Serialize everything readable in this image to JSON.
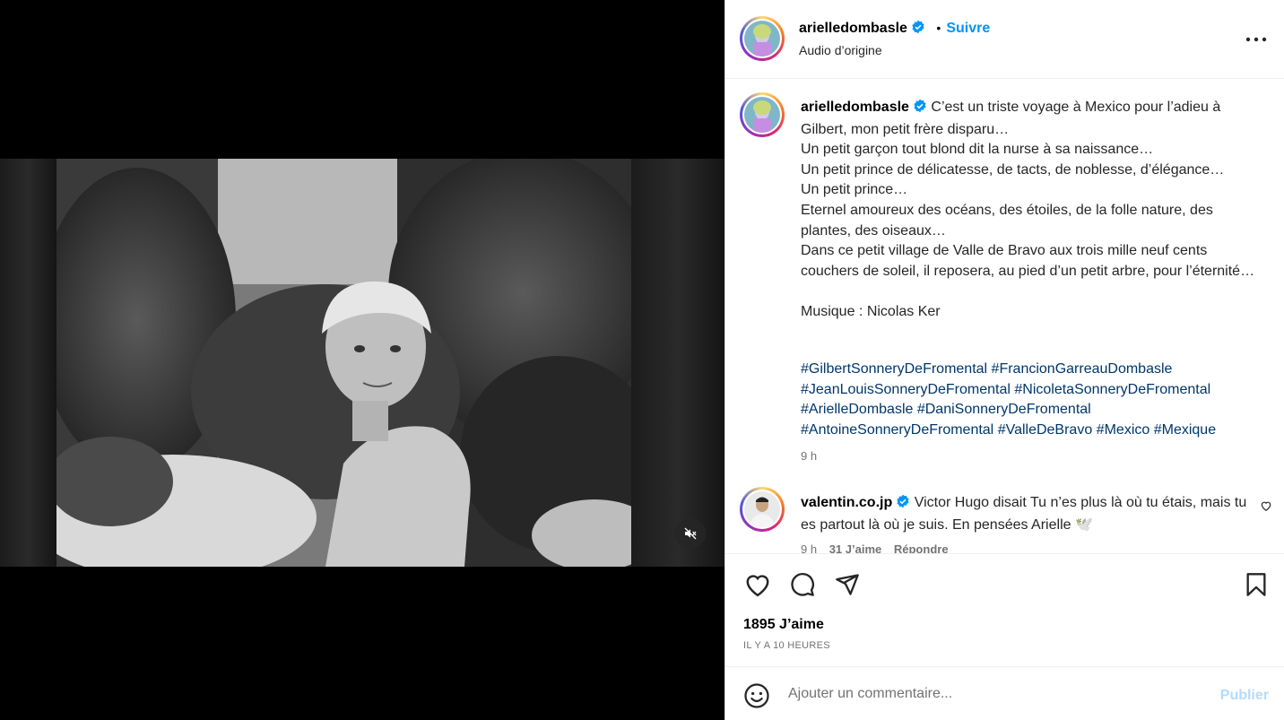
{
  "post": {
    "username": "arielledombasle",
    "follow_label": "Suivre",
    "separator": "•",
    "audio": "Audio d’origine",
    "more_label": "•••"
  },
  "caption": {
    "username": "arielledombasle",
    "text": "C’est un triste voyage à Mexico pour l’adieu à Gilbert, mon petit frère disparu…\nUn petit garçon tout blond dit la nurse à sa naissance…\nUn petit prince de délicatesse, de tacts, de noblesse, d’élégance…\nUn petit prince…\nEternel amoureux des océans, des étoiles, de la folle nature, des plantes, des oiseaux…\nDans ce petit village de Valle de Bravo aux trois mille neuf cents couchers de soleil, il reposera, au pied d’un petit arbre, pour l’éternité…\n\nMusique : Nicolas Ker",
    "hashtags": [
      "#GilbertSonneryDeFromental",
      "#FrancionGarreauDombasle",
      "#JeanLouisSonneryDeFromental",
      "#NicoletaSonneryDeFromental",
      "#ArielleDombasle",
      "#DaniSonneryDeFromental",
      "#AntoineSonneryDeFromental",
      "#ValleDeBravo",
      "#Mexico",
      "#Mexique"
    ],
    "time": "9 h"
  },
  "comment": {
    "username": "valentin.co.jp",
    "text": "Victor Hugo disait Tu n’es plus là où tu étais, mais tu es partout là où je suis. En pensées Arielle 🕊️",
    "time": "9 h",
    "likes": "31 J’aime",
    "reply": "Répondre"
  },
  "stats": {
    "likes": "1895 J’aime",
    "ago": "IL Y A 10 HEURES"
  },
  "composer": {
    "placeholder": "Ajouter un commentaire...",
    "publish": "Publier"
  },
  "colors": {
    "link": "#0095f6",
    "hashtag": "#00376b",
    "muted": "#737373",
    "publish_disabled": "#b3dbff"
  }
}
